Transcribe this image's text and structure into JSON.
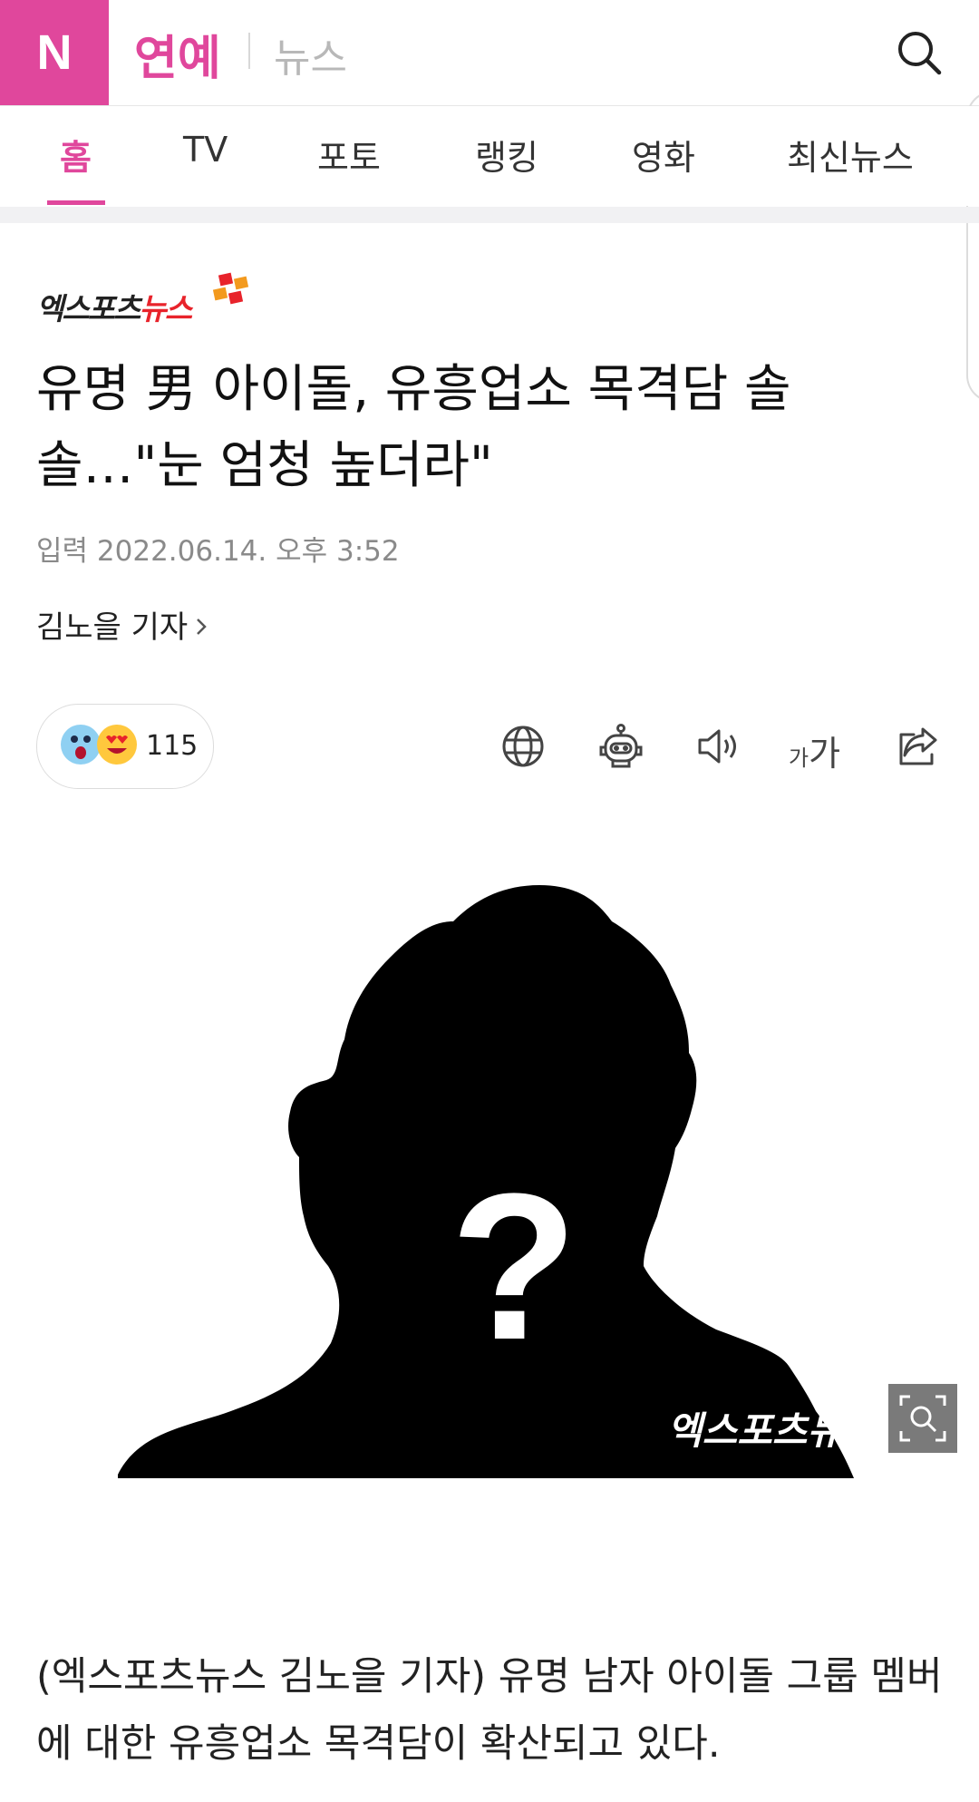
{
  "header": {
    "logo": "N",
    "section": "연예",
    "subsection": "뉴스",
    "search_icon": "search-icon"
  },
  "tabs": [
    {
      "label": "홈",
      "active": true
    },
    {
      "label": "TV",
      "active": false
    },
    {
      "label": "포토",
      "active": false
    },
    {
      "label": "랭킹",
      "active": false
    },
    {
      "label": "영화",
      "active": false
    },
    {
      "label": "최신뉴스",
      "active": false
    }
  ],
  "article": {
    "press_name_part1": "엑스포츠",
    "press_name_part2": "뉴스",
    "title": "유명 男 아이돌, 유흥업소 목격담 솔솔…\"눈 엄청 높더라\"",
    "date_label": "입력",
    "date_value": "2022.06.14. 오후 3:52",
    "reporter": "김노을 기자",
    "reaction_count": "115",
    "photo_watermark": "엑스포츠뉴스",
    "body": "(엑스포츠뉴스 김노을 기자) 유명 남자 아이돌 그룹 멤버에 대한 유흥업소 목격담이 확산되고 있다.",
    "font_size_small": "가",
    "font_size_large": "가"
  },
  "toolbar_icons": [
    "globe-icon",
    "robot-icon",
    "speaker-icon",
    "font-size-icon",
    "share-icon"
  ],
  "colors": {
    "accent": "#e0479c",
    "press_red": "#e8232b"
  }
}
